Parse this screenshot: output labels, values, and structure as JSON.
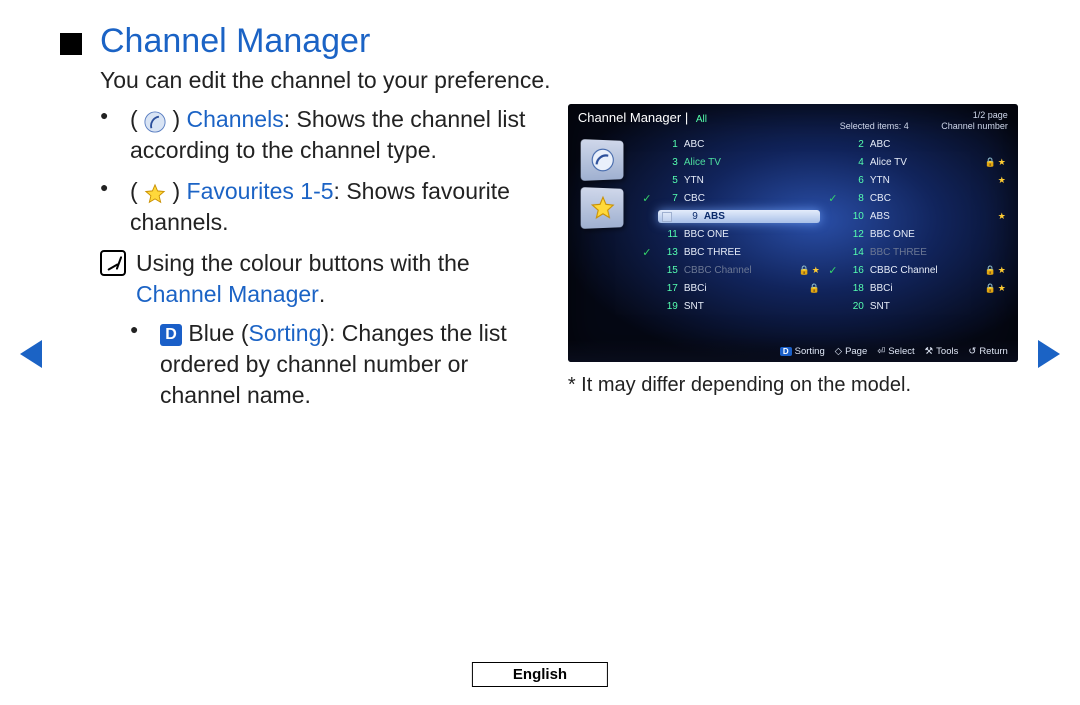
{
  "title": "Channel Manager",
  "intro": "You can edit the channel to your preference.",
  "bullets": {
    "channels_label": "Channels",
    "channels_rest": ": Shows the channel list according to the channel type.",
    "fav_label": "Favourites 1",
    "fav_dash": "-",
    "fav_num": "5",
    "fav_rest": ": Shows favourite channels."
  },
  "note": {
    "line1_pre": "Using the colour buttons with the ",
    "line1_link": "Channel Manager",
    "line1_post": "."
  },
  "sub": {
    "key": "D",
    "pre": " Blue (",
    "sort": "Sorting",
    "post": "): Changes the list ordered by channel number or channel name."
  },
  "footnote_star": "*",
  "footnote": " It may differ depending on the model.",
  "language": "English",
  "tv": {
    "title": "Channel Manager",
    "allTag": "All",
    "pageInfo": "1/2 page",
    "selectedLabel": "Selected items: 4",
    "sortLabel": "Channel number",
    "footer": {
      "sortKey": "D",
      "sort": "Sorting",
      "page": "Page",
      "select": "Select",
      "tools": "Tools",
      "return": "Return"
    },
    "rows": [
      {
        "l": {
          "check": false,
          "n": "1",
          "name": "ABC"
        },
        "r": {
          "check": false,
          "n": "2",
          "name": "ABC"
        }
      },
      {
        "l": {
          "check": false,
          "n": "3",
          "name": "Alice TV",
          "hl": true
        },
        "r": {
          "check": false,
          "n": "4",
          "name": "Alice TV",
          "lock": true,
          "star": true
        }
      },
      {
        "l": {
          "check": false,
          "n": "5",
          "name": "YTN"
        },
        "r": {
          "check": false,
          "n": "6",
          "name": "YTN",
          "star": true
        }
      },
      {
        "l": {
          "check": true,
          "n": "7",
          "name": "CBC"
        },
        "r": {
          "check": true,
          "n": "8",
          "name": "CBC"
        }
      },
      {
        "l": {
          "sel": true,
          "box": true,
          "n": "9",
          "name": "ABS"
        },
        "r": {
          "check": false,
          "n": "10",
          "name": "ABS",
          "star": true
        }
      },
      {
        "l": {
          "check": false,
          "n": "11",
          "name": "BBC ONE"
        },
        "r": {
          "check": false,
          "n": "12",
          "name": "BBC ONE"
        }
      },
      {
        "l": {
          "check": true,
          "n": "13",
          "name": "BBC THREE"
        },
        "r": {
          "check": false,
          "n": "14",
          "name": "BBC THREE",
          "dim": true
        }
      },
      {
        "l": {
          "check": false,
          "n": "15",
          "name": "CBBC Channel",
          "dim": true,
          "lock": true,
          "star": true
        },
        "r": {
          "check": true,
          "n": "16",
          "name": "CBBC Channel",
          "lock": true,
          "star": true
        }
      },
      {
        "l": {
          "check": false,
          "n": "17",
          "name": "BBCi",
          "lock": true
        },
        "r": {
          "check": false,
          "n": "18",
          "name": "BBCi",
          "lock": true,
          "star": true
        }
      },
      {
        "l": {
          "check": false,
          "n": "19",
          "name": "SNT"
        },
        "r": {
          "check": false,
          "n": "20",
          "name": "SNT"
        }
      }
    ]
  }
}
